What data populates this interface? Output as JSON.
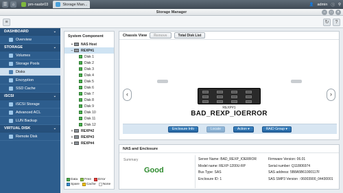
{
  "topbar": {
    "tabs": [
      "pm-nasbr03",
      "Storage Man..."
    ],
    "user": "admin",
    "colors": {
      "bar": "#4a5561",
      "accent": "#4aa0da"
    }
  },
  "window": {
    "title": "Storage Manager"
  },
  "sidebar": {
    "sections": [
      {
        "label": "DASHBOARD",
        "items": [
          "Overview"
        ]
      },
      {
        "label": "STORAGE",
        "items": [
          "Volumes",
          "Storage Pools",
          "Disks",
          "Encryption",
          "SSD Cache"
        ]
      },
      {
        "label": "iSCSI",
        "items": [
          "iSCSI Storage",
          "Advanced ACL",
          "LUN Backup"
        ]
      },
      {
        "label": "VIRTUAL DISK",
        "items": [
          "Remote Disk"
        ]
      }
    ],
    "active": "Disks"
  },
  "component": {
    "title": "System Component",
    "tree": [
      {
        "label": "NAS Host",
        "level": 0,
        "exp": "+"
      },
      {
        "label": "REXP#1",
        "level": 0,
        "exp": "−"
      },
      {
        "label": "Disk 1",
        "level": 1
      },
      {
        "label": "Disk 2",
        "level": 1
      },
      {
        "label": "Disk 3",
        "level": 1
      },
      {
        "label": "Disk 4",
        "level": 1
      },
      {
        "label": "Disk 5",
        "level": 1
      },
      {
        "label": "Disk 6",
        "level": 1
      },
      {
        "label": "Disk 7",
        "level": 1
      },
      {
        "label": "Disk 8",
        "level": 1
      },
      {
        "label": "Disk 9",
        "level": 1
      },
      {
        "label": "Disk 10",
        "level": 1
      },
      {
        "label": "Disk 11",
        "level": 1
      },
      {
        "label": "Disk 12",
        "level": 1
      },
      {
        "label": "REXP#2",
        "level": 0,
        "exp": "+"
      },
      {
        "label": "REXP#3",
        "level": 0,
        "exp": "+"
      },
      {
        "label": "REXP#4",
        "level": 0,
        "exp": "+"
      }
    ],
    "legend": [
      [
        {
          "label": "Data",
          "color": "#4caf50"
        },
        {
          "label": "Free",
          "color": "#8bc34a"
        },
        {
          "label": "Error",
          "color": "#e53935"
        }
      ],
      [
        {
          "label": "Spare",
          "color": "#3b8fd0"
        },
        {
          "label": "Cache",
          "color": "#f4c20d"
        },
        {
          "label": "None",
          "color": "#ffffff"
        }
      ]
    ]
  },
  "chassis": {
    "title": "Chassis View",
    "remove_label": "Remove",
    "total_disk_list_label": "Total Disk List",
    "expander_label": "REXP#1",
    "expander_name": "BAD_REXP_IOERROR",
    "actions": [
      "Enclosure Info",
      "Locate",
      "Action ▾",
      "RAID Group ▾"
    ]
  },
  "enclosure": {
    "title": "NAS and Enclosure",
    "summary_label": "Summary",
    "summary_value": "Good",
    "col1": [
      "Server Name: BAD_REXP_IOERROR",
      "Model name: REXP-1200U-RP",
      "Bus Type: SAS",
      "Enclosure ID: 1"
    ],
    "col2": [
      "Firmware Version: 06.01",
      "Serial number: Q118I06974",
      "SAS address: 5B8A5B61000117F",
      "SAS SMP3 Version : 06003900_04430001"
    ]
  }
}
